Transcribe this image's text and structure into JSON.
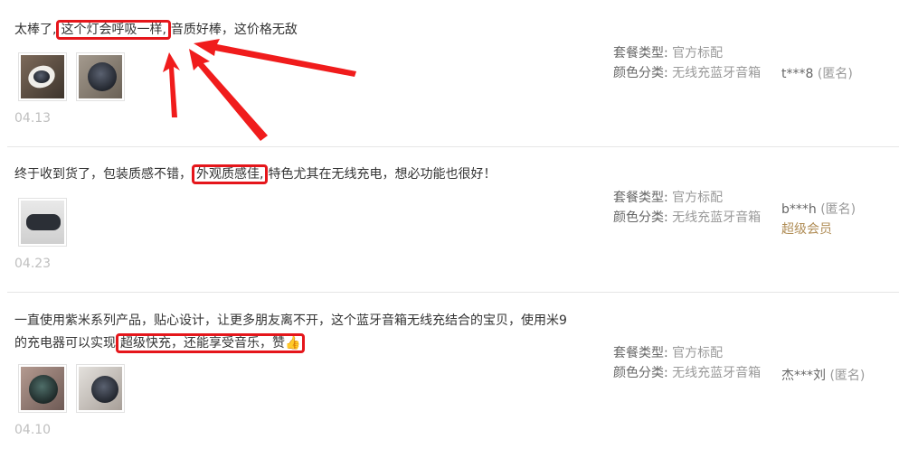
{
  "reviews": [
    {
      "segments": [
        {
          "text": "太棒了,",
          "hl": false
        },
        {
          "text": "这个灯会呼吸一样,",
          "hl": true
        },
        {
          "text": "音质好棒，这价格无敌",
          "hl": false
        }
      ],
      "photos": 2,
      "date": "04.13",
      "package_label": "套餐类型:",
      "package_value": "官方标配",
      "color_label": "颜色分类:",
      "color_value": "无线充蓝牙音箱",
      "user_name": "t***8",
      "user_anon": "(匿名)",
      "member": ""
    },
    {
      "segments": [
        {
          "text": "终于收到货了，包装质感不错，",
          "hl": false
        },
        {
          "text": "外观质感佳,",
          "hl": true
        },
        {
          "text": "特色尤其在无线充电，想必功能也很好！",
          "hl": false
        }
      ],
      "photos": 1,
      "date": "04.23",
      "package_label": "套餐类型:",
      "package_value": "官方标配",
      "color_label": "颜色分类:",
      "color_value": "无线充蓝牙音箱",
      "user_name": "b***h",
      "user_anon": "(匿名)",
      "member": "超级会员"
    },
    {
      "segments": [
        {
          "text": "一直使用紫米系列产品，贴心设计，让更多朋友离不开，这个蓝牙音箱无线充结合的宝贝，使用米9的充电器可以实现",
          "hl": false
        },
        {
          "text": "超级快充，还能享受音乐，赞👍",
          "hl": true
        }
      ],
      "photos": 2,
      "date": "04.10",
      "package_label": "套餐类型:",
      "package_value": "官方标配",
      "color_label": "颜色分类:",
      "color_value": "无线充蓝牙音箱",
      "user_name": "杰***刘",
      "user_anon": "(匿名)",
      "member": ""
    }
  ],
  "colors": {
    "highlight": "#e5161b",
    "arrow": "#f01c1c",
    "member": "#b08d56"
  },
  "icons": [
    "thumbs-up-icon",
    "annotation-arrow"
  ]
}
